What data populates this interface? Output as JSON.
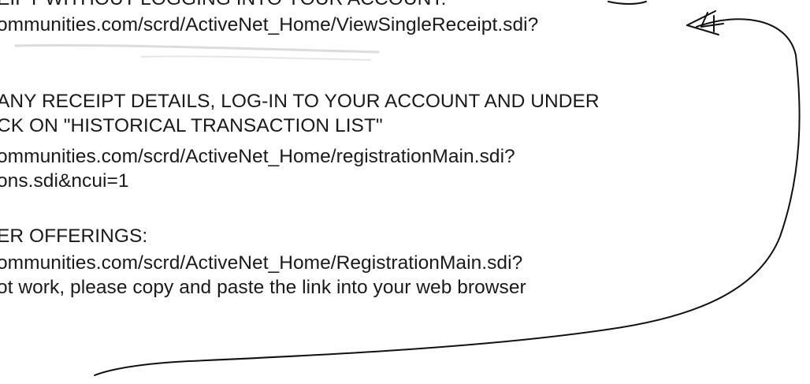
{
  "document": {
    "lines": [
      "EIPT WITHOUT LOGGING INTO YOUR ACCOUNT:",
      "ommunities.com/scrd/ActiveNet_Home/ViewSingleReceipt.sdi?",
      "ANY RECEIPT DETAILS, LOG-IN TO YOUR ACCOUNT AND UNDER",
      "CK ON \"HISTORICAL TRANSACTION LIST\"",
      "ommunities.com/scrd/ActiveNet_Home/registrationMain.sdi?",
      "ons.sdi&ncui=1",
      "ER OFFERINGS:",
      "ommunities.com/scrd/ActiveNet_Home/RegistrationMain.sdi?",
      "ot work, please copy and paste the link into your web browser"
    ]
  },
  "annotation": {
    "marker_text": "4"
  },
  "colors": {
    "text": "#1a1a1a",
    "ink": "#111111",
    "background": "#ffffff"
  }
}
